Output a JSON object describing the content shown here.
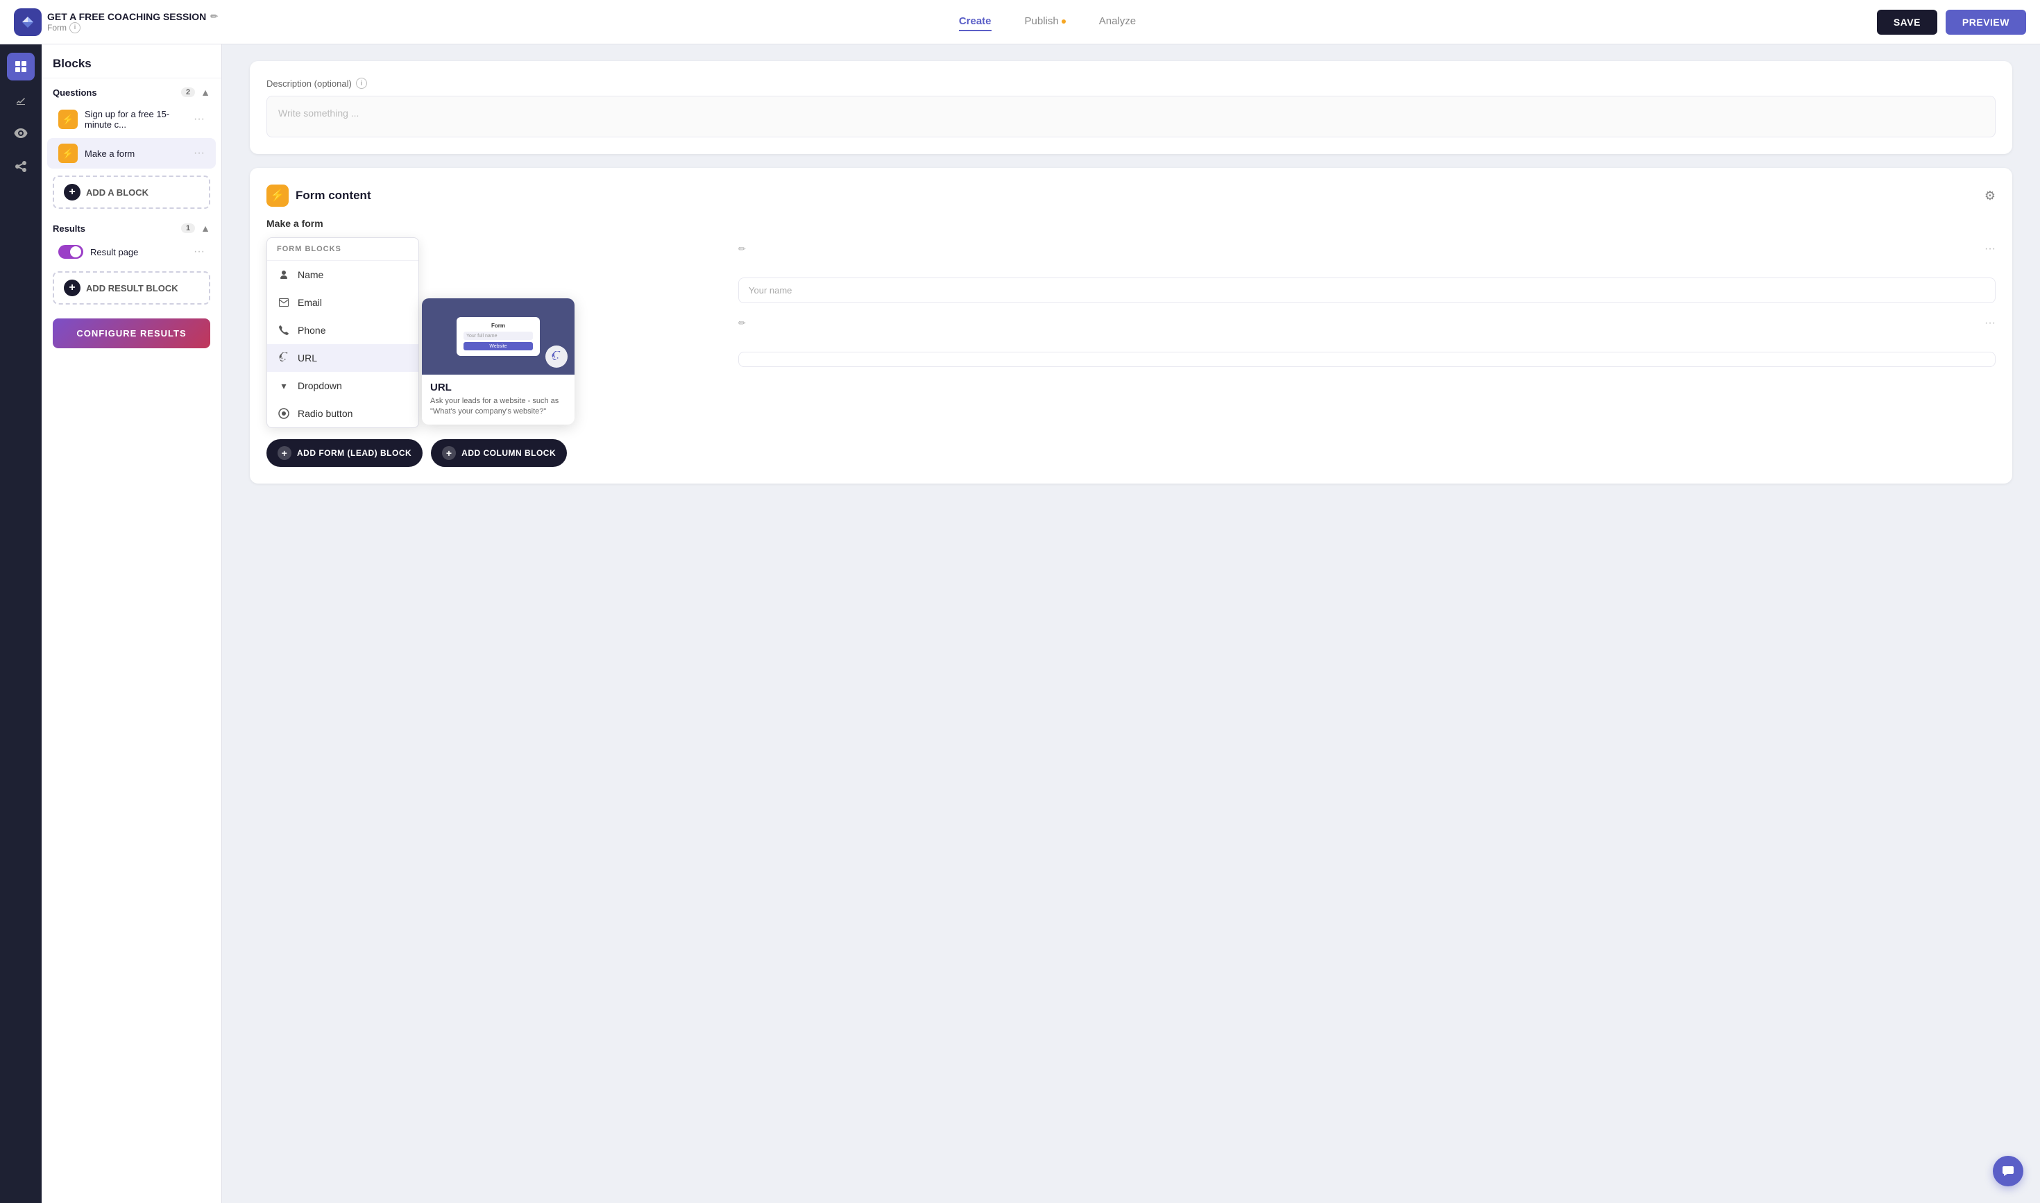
{
  "app": {
    "logo_alt": "Logo",
    "title": "GET A FREE COACHING SESSION",
    "subtitle": "Form",
    "edit_icon": "✏"
  },
  "topnav": {
    "tabs": [
      {
        "id": "create",
        "label": "Create",
        "active": true,
        "dot": false
      },
      {
        "id": "publish",
        "label": "Publish",
        "active": false,
        "dot": true
      },
      {
        "id": "analyze",
        "label": "Analyze",
        "active": false,
        "dot": false
      }
    ],
    "save_label": "SAVE",
    "preview_label": "PREVIEW"
  },
  "iconbar": {
    "items": [
      {
        "id": "blocks",
        "icon": "grid",
        "active": true
      },
      {
        "id": "style",
        "icon": "style",
        "active": false
      },
      {
        "id": "settings",
        "icon": "gear",
        "active": false
      },
      {
        "id": "share",
        "icon": "share",
        "active": false
      }
    ]
  },
  "sidebar": {
    "title": "Blocks",
    "sections": {
      "questions": {
        "label": "Questions",
        "count": "2",
        "items": [
          {
            "id": "q1",
            "label": "Sign up for a free 15-minute c...",
            "icon_type": "yellow"
          },
          {
            "id": "q2",
            "label": "Make a form",
            "icon_type": "yellow",
            "active": true
          }
        ],
        "add_btn": "ADD A BLOCK"
      },
      "results": {
        "label": "Results",
        "count": "1",
        "items": [
          {
            "id": "r1",
            "label": "Result page",
            "icon_type": "toggle"
          }
        ],
        "add_btn": "ADD RESULT BLOCK"
      }
    },
    "configure_btn": "CONFIGURE RESULTS"
  },
  "main": {
    "description_section": {
      "label": "Description (optional)",
      "placeholder": "Write something ..."
    },
    "form_content": {
      "title": "Form content",
      "subtitle": "Make a form",
      "gear_icon": "⚙",
      "form_blocks_title": "FORM BLOCKS",
      "form_block_items": [
        {
          "id": "name",
          "label": "Name",
          "icon": "person"
        },
        {
          "id": "email",
          "label": "Email",
          "icon": "email"
        },
        {
          "id": "phone",
          "label": "Phone",
          "icon": "phone"
        },
        {
          "id": "url",
          "label": "URL",
          "icon": "link",
          "active": true
        },
        {
          "id": "dropdown",
          "label": "Dropdown",
          "icon": "chevron"
        },
        {
          "id": "radio",
          "label": "Radio button",
          "icon": "radio"
        }
      ],
      "url_tooltip": {
        "preview_title": "Form",
        "preview_field1": "Your full name",
        "preview_field2": "Website",
        "title": "URL",
        "description": "Ask your leads for a website - such as \"What's your company's website?\""
      },
      "form_rows": [
        {
          "id": "row1",
          "placeholder": ""
        },
        {
          "id": "row2",
          "placeholder": ""
        }
      ],
      "add_form_btn": "ADD FORM (LEAD) BLOCK",
      "add_column_btn": "ADD COLUMN BLOCK"
    }
  }
}
